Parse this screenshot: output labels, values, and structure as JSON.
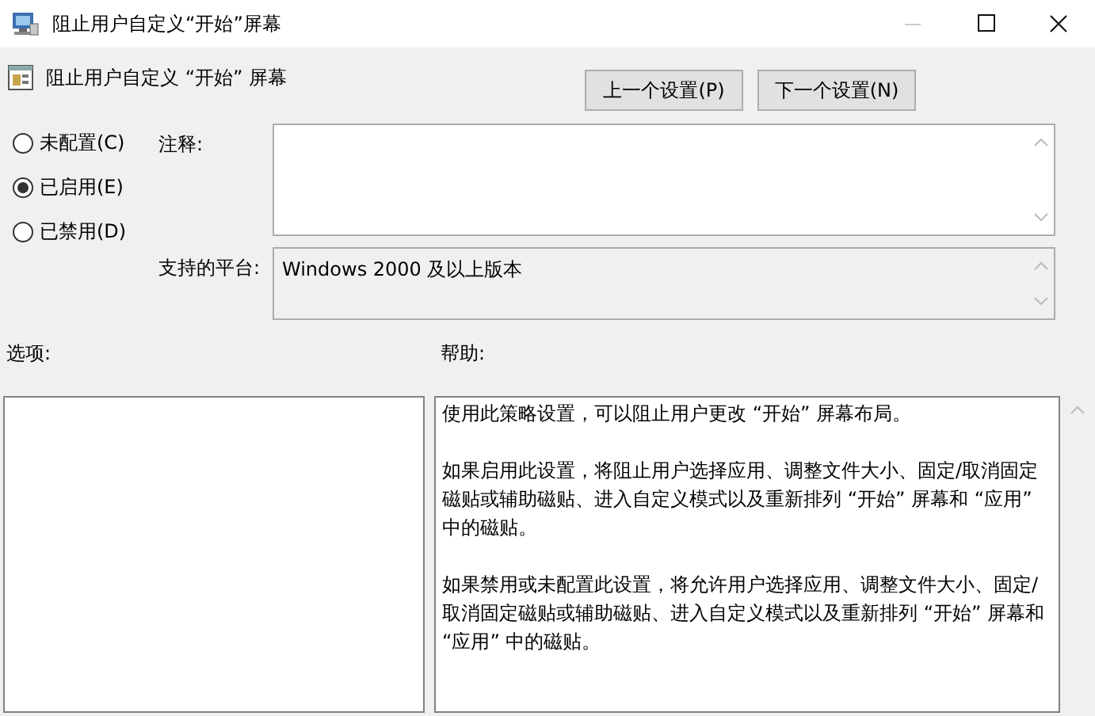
{
  "window": {
    "title": "阻止用户自定义“开始”屏幕",
    "minimize_disabled": true
  },
  "header": {
    "title": "阻止用户自定义 “开始” 屏幕",
    "buttons": [
      "上一个设置(P)",
      "下一个设置(N)"
    ]
  },
  "state_options": [
    {
      "label": "未配置(C)",
      "selected": false
    },
    {
      "label": "已启用(E)",
      "selected": true
    },
    {
      "label": "已禁用(D)",
      "selected": false
    }
  ],
  "comment": {
    "label": "注释:"
  },
  "platform": {
    "label": "支持的平台:",
    "value": "Windows 2000 及以上版本"
  },
  "options": {
    "label": "选项:"
  },
  "help": {
    "label": "帮助:",
    "paragraphs": [
      "使用此策略设置，可以阻止用户更改 “开始” 屏幕布局。",
      "如果启用此设置，将阻止用户选择应用、调整文件大小、固定/取消固定磁贴或辅助磁贴、进入自定义模式以及重新排列 “开始” 屏幕和 “应用” 中的磁贴。",
      "如果禁用或未配置此设置，将允许用户选择应用、调整文件大小、固定/取消固定磁贴或辅助磁贴、进入自定义模式以及重新排列 “开始” 屏幕和 “应用” 中的磁贴。"
    ]
  }
}
